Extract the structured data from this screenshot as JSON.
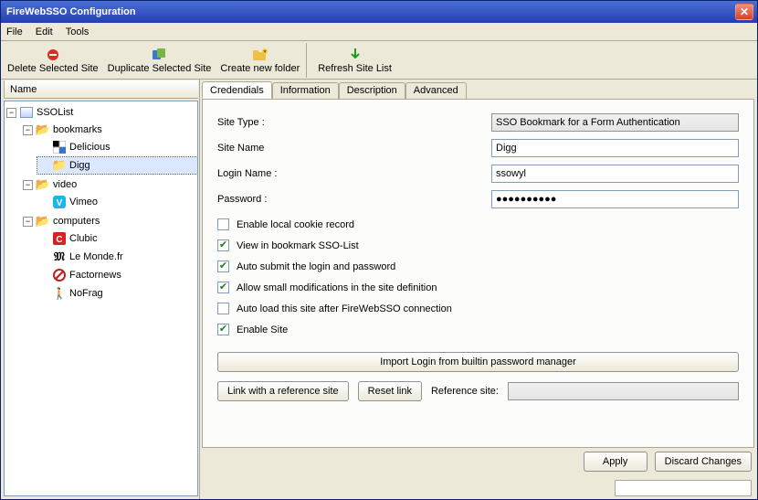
{
  "window": {
    "title": "FireWebSSO Configuration"
  },
  "menu": {
    "file": "File",
    "edit": "Edit",
    "tools": "Tools"
  },
  "toolbar": {
    "delete": "Delete Selected Site",
    "duplicate": "Duplicate Selected Site",
    "new_folder": "Create new folder",
    "refresh": "Refresh Site List"
  },
  "left": {
    "header": "Name",
    "root": "SSOList",
    "folders": {
      "bookmarks": "bookmarks",
      "video": "video",
      "computers": "computers"
    },
    "items": {
      "delicious": "Delicious",
      "digg": "Digg",
      "vimeo": "Vimeo",
      "clubic": "Clubic",
      "lemonde": "Le Monde.fr",
      "factornews": "Factornews",
      "nofrag": "NoFrag"
    }
  },
  "tabs": {
    "credentials": "Credendials",
    "information": "Information",
    "description": "Description",
    "advanced": "Advanced"
  },
  "form": {
    "site_type_label": "Site Type :",
    "site_type_value": "SSO Bookmark for a Form Authentication",
    "site_name_label": "Site Name",
    "site_name_value": "Digg",
    "login_label": "Login Name :",
    "login_value": "ssowyl",
    "password_label": "Password :",
    "password_value": "●●●●●●●●●●",
    "chk_cookie": "Enable local cookie record",
    "chk_view": "View in bookmark SSO-List",
    "chk_submit": "Auto submit the login and password",
    "chk_modif": "Allow small modifications in the site definition",
    "chk_autoload": "Auto load this site after FireWebSSO connection",
    "chk_enable": "Enable Site",
    "import_btn": "Import Login from builtin password manager",
    "link_btn": "Link with a reference site",
    "reset_btn": "Reset link",
    "ref_label": "Reference site:"
  },
  "checks": {
    "cookie": false,
    "view": true,
    "submit": true,
    "modif": true,
    "autoload": false,
    "enable": true
  },
  "buttons": {
    "apply": "Apply",
    "discard": "Discard Changes"
  }
}
